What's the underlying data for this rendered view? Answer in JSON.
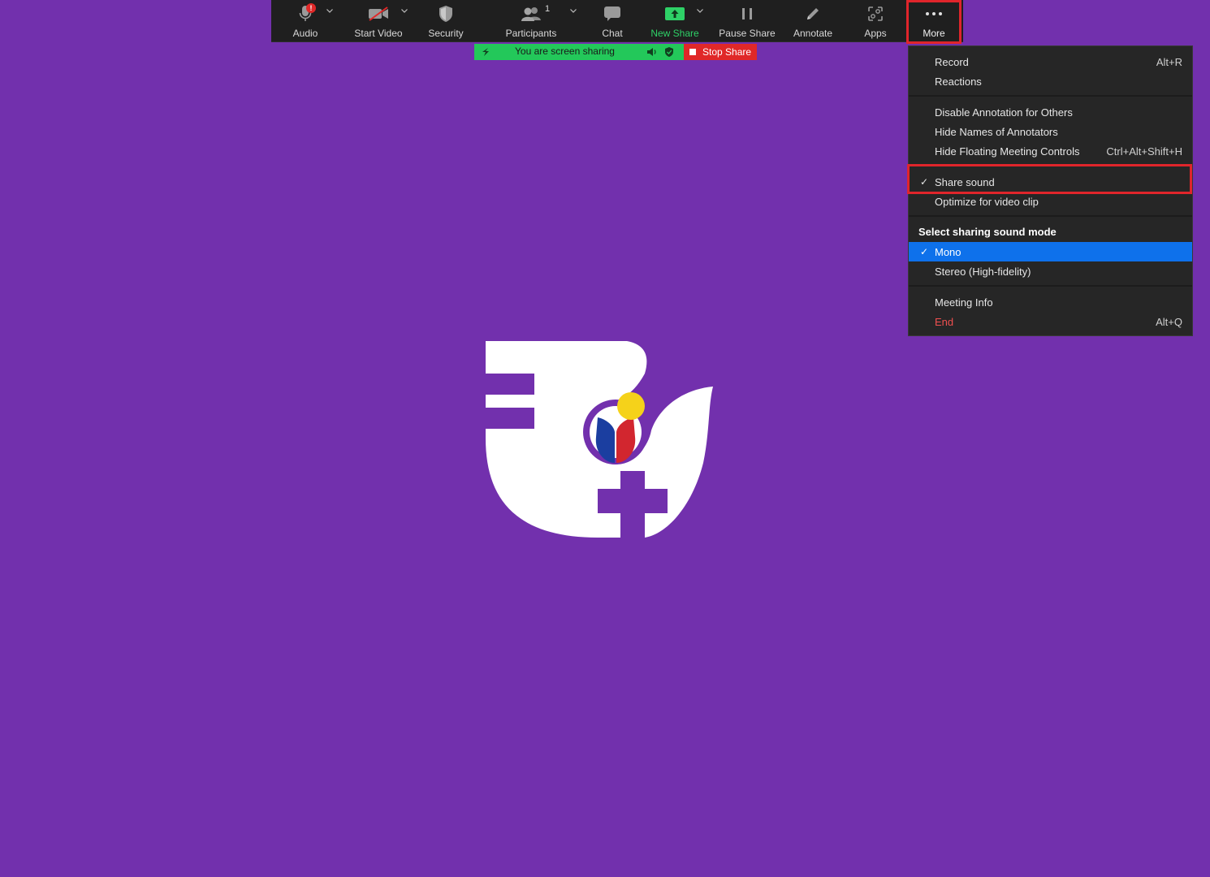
{
  "colors": {
    "background": "#7230ad",
    "toolbar": "#1f1f1f",
    "green": "#23c85a",
    "red": "#e02828",
    "menu_bg": "#262626",
    "selected": "#0e71eb",
    "highlight": "#e0252b"
  },
  "toolbar": {
    "audio": {
      "label": "Audio",
      "badge": "!"
    },
    "video": {
      "label": "Start Video"
    },
    "security": {
      "label": "Security"
    },
    "participants": {
      "label": "Participants",
      "count": "1"
    },
    "chat": {
      "label": "Chat"
    },
    "new_share": {
      "label": "New Share"
    },
    "pause_share": {
      "label": "Pause Share"
    },
    "annotate": {
      "label": "Annotate"
    },
    "apps": {
      "label": "Apps"
    },
    "more": {
      "label": "More"
    }
  },
  "sharing_banner": {
    "text": "You are screen sharing",
    "stop_label": "Stop Share"
  },
  "more_menu": {
    "record": {
      "label": "Record",
      "shortcut": "Alt+R"
    },
    "reactions": {
      "label": "Reactions"
    },
    "disable_annotation": {
      "label": "Disable Annotation for Others"
    },
    "hide_names": {
      "label": "Hide Names of Annotators"
    },
    "hide_controls": {
      "label": "Hide Floating Meeting Controls",
      "shortcut": "Ctrl+Alt+Shift+H"
    },
    "share_sound": {
      "label": "Share sound",
      "checked": true,
      "check": "✓"
    },
    "optimize_video": {
      "label": "Optimize for video clip"
    },
    "sound_mode_header": "Select sharing sound mode",
    "mono": {
      "label": "Mono",
      "checked": true,
      "check": "✓"
    },
    "stereo": {
      "label": "Stereo (High-fidelity)"
    },
    "meeting_info": {
      "label": "Meeting Info"
    },
    "end": {
      "label": "End",
      "shortcut": "Alt+Q"
    }
  }
}
